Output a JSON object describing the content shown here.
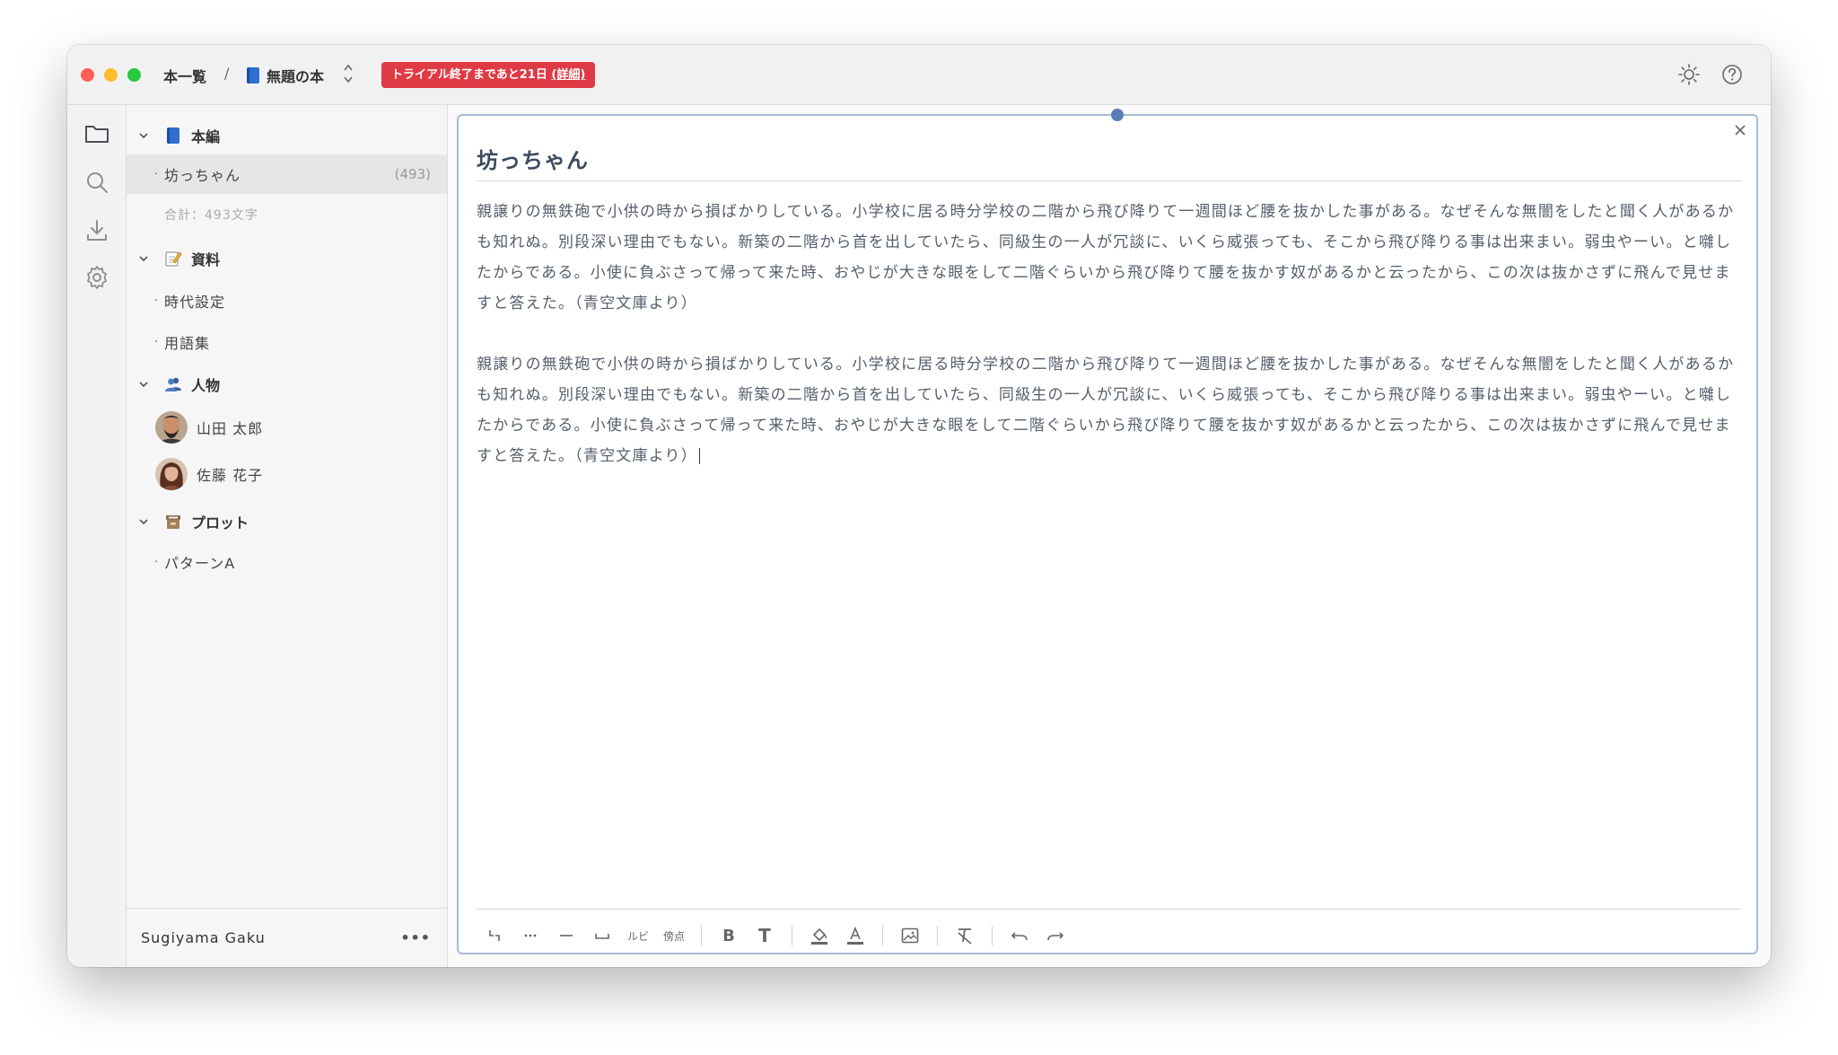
{
  "titlebar": {
    "home": "本一覧",
    "separator": "/",
    "book_title": "無題の本",
    "trial_text": "トライアル終了まであと21日",
    "trial_detail": "(詳細)"
  },
  "tree": {
    "sections": [
      {
        "label": "本編",
        "emoji": "book-icon"
      },
      {
        "label": "資料",
        "emoji": "memo-icon"
      },
      {
        "label": "人物",
        "emoji": "people-icon"
      },
      {
        "label": "プロット",
        "emoji": "file-box-icon"
      }
    ],
    "main_items": [
      {
        "label": "坊っちゃん",
        "count": "(493)"
      }
    ],
    "subtotal": "合計：493文字",
    "material_items": [
      {
        "label": "時代設定"
      },
      {
        "label": "用語集"
      }
    ],
    "people": [
      {
        "label": "山田 太郎"
      },
      {
        "label": "佐藤 花子"
      }
    ],
    "plot_items": [
      {
        "label": "パターンA"
      }
    ],
    "dot": "·"
  },
  "user": {
    "name": "Sugiyama Gaku",
    "more": "•••"
  },
  "editor": {
    "title": "坊っちゃん",
    "paragraphs": [
      "親譲りの無鉄砲で小供の時から損ばかりしている。小学校に居る時分学校の二階から飛び降りて一週間ほど腰を抜かした事がある。なぜそんな無闇をしたと聞く人があるかも知れぬ。別段深い理由でもない。新築の二階から首を出していたら、同級生の一人が冗談に、いくら威張っても、そこから飛び降りる事は出来まい。弱虫やーい。と囃したからである。小使に負ぶさって帰って来た時、おやじが大きな眼をして二階ぐらいから飛び降りて腰を抜かす奴があるかと云ったから、この次は抜かさずに飛んで見せますと答えた。（青空文庫より）",
      "親譲りの無鉄砲で小供の時から損ばかりしている。小学校に居る時分学校の二階から飛び降りて一週間ほど腰を抜かした事がある。なぜそんな無闇をしたと聞く人があるかも知れぬ。別段深い理由でもない。新築の二階から首を出していたら、同級生の一人が冗談に、いくら威張っても、そこから飛び降りる事は出来まい。弱虫やーい。と囃したからである。小使に負ぶさって帰って来た時、おやじが大きな眼をして二階ぐらいから飛び降りて腰を抜かす奴があるかと云ったから、この次は抜かさずに飛んで見せますと答えた。（青空文庫より）"
    ]
  },
  "toolbar": {
    "ruby": "ルビ",
    "emphasis": "傍点",
    "bold": "B",
    "text": "T",
    "color_text": "A"
  },
  "colors": {
    "trial_badge": "#e03a45",
    "accent": "#5b7fb4",
    "book_blue": "#2f6fd0"
  }
}
